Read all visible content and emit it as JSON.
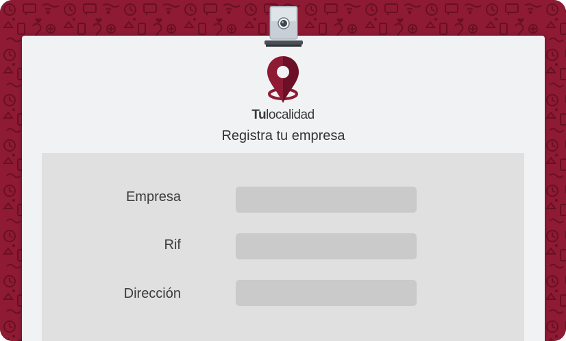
{
  "brand": {
    "name_bold": "Tu",
    "name_regular": "localidad",
    "primary_color": "#8e1a33",
    "pin_icon": "map-pin-icon"
  },
  "page": {
    "title": "Registra tu empresa"
  },
  "form": {
    "fields": [
      {
        "label": "Empresa",
        "value": "",
        "placeholder": ""
      },
      {
        "label": "Rif",
        "value": "",
        "placeholder": ""
      },
      {
        "label": "Dirección",
        "value": "",
        "placeholder": ""
      }
    ]
  },
  "colors": {
    "card_background": "#f1f2f4",
    "panel_background": "#e0e0e0",
    "input_background": "#cacaca"
  }
}
